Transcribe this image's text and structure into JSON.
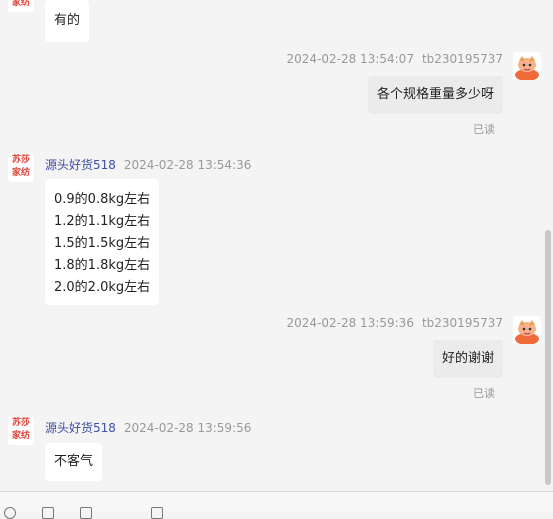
{
  "seller": {
    "name": "源头好货518",
    "avatar_lines": [
      "苏莎",
      "家纺"
    ]
  },
  "buyer": {
    "id": "tb230195737"
  },
  "messages": [
    {
      "text": "有的"
    },
    {
      "time": "2024-02-28 13:54:07",
      "text": "各个规格重量多少呀",
      "read": "已读"
    },
    {
      "time": "2024-02-28 13:54:36",
      "lines": [
        "0.9的0.8kg左右",
        "1.2的1.1kg左右",
        "1.5的1.5kg左右",
        "1.8的1.8kg左右",
        "2.0的2.0kg左右"
      ]
    },
    {
      "time": "2024-02-28 13:59:36",
      "text": "好的谢谢",
      "read": "已读"
    },
    {
      "time": "2024-02-28 13:59:56",
      "text": "不客气"
    }
  ],
  "icons": {
    "buyer_avatar": "cartoon-avatar-icon",
    "toolbar": [
      "emoji-icon",
      "image-icon",
      "file-icon",
      "history-icon"
    ]
  }
}
